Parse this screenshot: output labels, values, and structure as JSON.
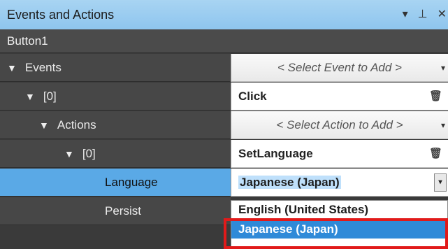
{
  "window": {
    "title": "Events and Actions",
    "object_name": "Button1"
  },
  "controls": {
    "dropdown": "▾",
    "pin": "⊥",
    "close": "✕"
  },
  "rows": {
    "events": {
      "label": "Events",
      "value": "< Select Event to Add >"
    },
    "event0": {
      "label": "[0]",
      "value": "Click"
    },
    "actions": {
      "label": "Actions",
      "value": "< Select Action to Add >"
    },
    "action0": {
      "label": "[0]",
      "value": "SetLanguage"
    },
    "language": {
      "label": "Language",
      "value": "Japanese (Japan)"
    },
    "persist": {
      "label": "Persist"
    }
  },
  "dropdown_options": [
    "English (United States)",
    "Japanese (Japan)"
  ],
  "icons": {
    "expand": "▼",
    "combo_arrow": "▾",
    "trash": "🗑"
  },
  "colors": {
    "selected_row": "#5aa9e6",
    "highlight_option": "#2f8ad8",
    "callout": "#e11a1a"
  }
}
